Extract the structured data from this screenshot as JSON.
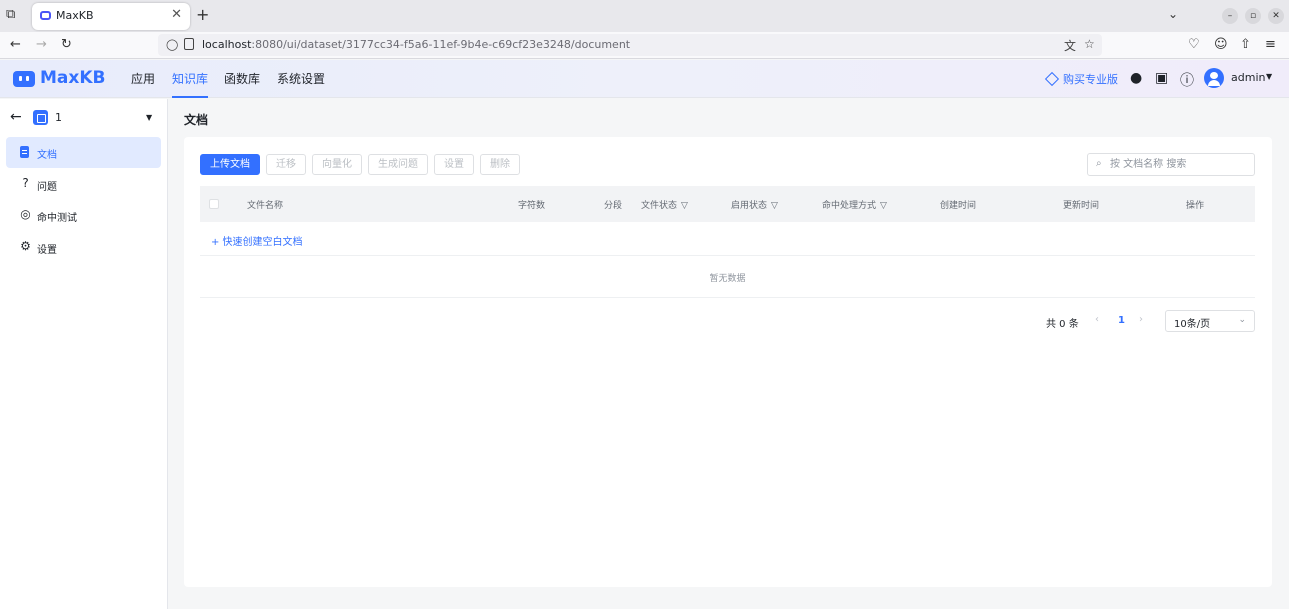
{
  "browser": {
    "tab_title": "MaxKB",
    "url_host": "localhost",
    "url_rest": ":8080/ui/dataset/3177cc34-f5a6-11ef-9b4e-c69cf23e3248/document"
  },
  "header": {
    "logo": "MaxKB",
    "menu": [
      "应用",
      "知识库",
      "函数库",
      "系统设置"
    ],
    "active_menu": "知识库",
    "buy_pro": "购买专业版",
    "user": "admin"
  },
  "sidebar": {
    "dataset_name": "1",
    "items": [
      {
        "label": "文档",
        "icon": "document-icon"
      },
      {
        "label": "问题",
        "icon": "question-icon"
      },
      {
        "label": "命中测试",
        "icon": "hit-test-icon"
      },
      {
        "label": "设置",
        "icon": "settings-icon"
      }
    ]
  },
  "main": {
    "title": "文档",
    "toolbar": {
      "upload": "上传文档",
      "migrate": "迁移",
      "vectorize": "向量化",
      "generate_questions": "生成问题",
      "settings": "设置",
      "delete": "删除"
    },
    "search_placeholder": "按 文档名称 搜索",
    "columns": [
      "文件名称",
      "字符数",
      "分段",
      "文件状态",
      "启用状态",
      "命中处理方式",
      "创建时间",
      "更新时间",
      "操作"
    ],
    "quick_create": "+ 快速创建空白文档",
    "empty_text": "暂无数据",
    "pagination": {
      "total": "共 0 条",
      "current_page": "1",
      "page_size": "10条/页"
    }
  },
  "colors": {
    "accent": "#3370ff",
    "active_bg": "#e1eaff"
  }
}
